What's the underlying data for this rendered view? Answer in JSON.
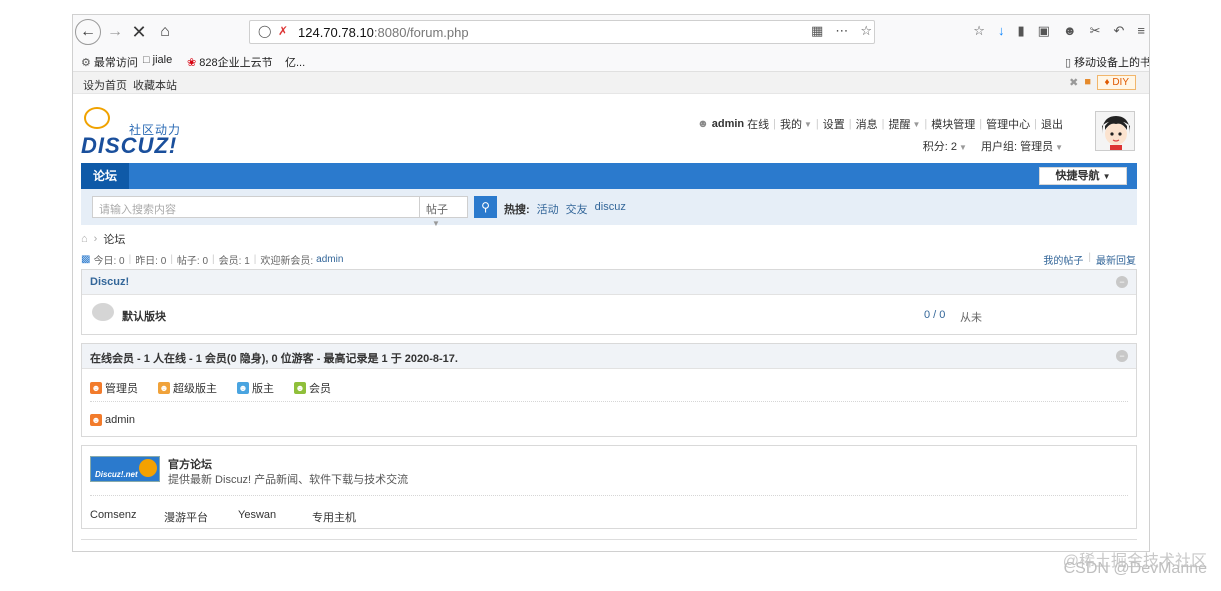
{
  "browser": {
    "url_host": "124.70.78.10",
    "url_rest": ":8080/forum.php",
    "bookmarks": [
      {
        "label": "最常访问"
      },
      {
        "label": "jiale"
      },
      {
        "label": "828企业上云节"
      },
      {
        "label": "亿..."
      }
    ],
    "mobile_bookmarks": "移动设备上的书签"
  },
  "site_top": {
    "set_home": "设为首页",
    "bookmark_site": "收藏本站",
    "diy": "DIY"
  },
  "logo": {
    "sub": "社区动力",
    "main": "DISCUZ!"
  },
  "user": {
    "name": "admin",
    "status": "在线",
    "links": [
      "我的",
      "设置",
      "消息",
      "提醒",
      "模块管理",
      "管理中心",
      "退出"
    ],
    "points": "积分: 2",
    "group": "用户组: 管理员"
  },
  "nav": {
    "forum_tab": "论坛",
    "quick_nav": "快捷导航"
  },
  "search": {
    "placeholder": "请输入搜索内容",
    "type": "帖子",
    "hot_label": "热搜:",
    "hot_words": [
      "活动",
      "交友",
      "discuz"
    ]
  },
  "breadcrumb": "论坛",
  "stats": {
    "today": "今日: 0",
    "yesterday": "昨日: 0",
    "posts": "帖子: 0",
    "members": "会员: 1",
    "welcome": "欢迎新会员:",
    "new_member": "admin",
    "my_posts": "我的帖子",
    "latest_replies": "最新回复"
  },
  "category": {
    "title": "Discuz!",
    "forum_name": "默认版块",
    "counts": "0 / 0",
    "last_post": "从未"
  },
  "online": {
    "title": "在线会员 - 1 人在线 - 1 会员(0 隐身), 0 位游客 - 最高记录是 1 于 2020-8-17.",
    "legend": [
      {
        "label": "管理员",
        "color": "#f27b2b"
      },
      {
        "label": "超级版主",
        "color": "#f0a23a"
      },
      {
        "label": "版主",
        "color": "#49a4e0"
      },
      {
        "label": "会员",
        "color": "#8fbf3a"
      }
    ],
    "user": "admin"
  },
  "links": {
    "logo_text": "Discuz!.net",
    "title": "官方论坛",
    "desc": "提供最新 Discuz! 产品新闻、软件下载与技术交流",
    "friends": [
      "Comsenz",
      "漫游平台",
      "Yeswan",
      "专用主机"
    ]
  },
  "watermark": {
    "line1": "@稀土掘金技术社区",
    "line2": "CSDN @DevMarine"
  }
}
